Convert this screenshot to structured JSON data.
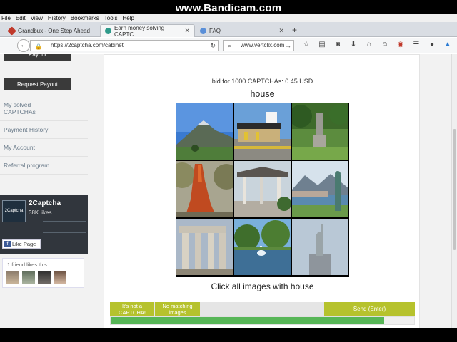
{
  "watermark": "www.Bandicam.com",
  "menu": [
    "File",
    "Edit",
    "View",
    "History",
    "Bookmarks",
    "Tools",
    "Help"
  ],
  "tabs": [
    {
      "label": "Grandbux - One Step Ahead",
      "icon": "grandbux-favicon",
      "color": "#c0392b"
    },
    {
      "label": "Earn money solving CAPTC...",
      "icon": "2captcha-favicon",
      "color": "#2e9a8a"
    },
    {
      "label": "FAQ",
      "icon": "globe-favicon",
      "color": "#5a8fd8"
    }
  ],
  "new_tab": "+",
  "url": "https://2captcha.com/cabinet",
  "search": "www.vertclix.com",
  "sidebar": {
    "button_top": "Payout",
    "request_payout": "Request Payout",
    "links": [
      "My solved CAPTCHAs",
      "Payment History",
      "My Account",
      "Referral program"
    ]
  },
  "facebook": {
    "logo": "2Captcha",
    "name": "2Captcha",
    "likes": "38K likes",
    "like_button": "Like Page",
    "friends": "1 friend likes this"
  },
  "captcha": {
    "bid": "bid for 1000 CAPTCHAs: 0.45 USD",
    "word": "house",
    "instruction": "Click all images with house",
    "not_captcha": "It's not a CAPTCHA!",
    "no_match": "No matching images",
    "send": "Send (Enter)",
    "progress": 0.9
  },
  "colors": {
    "accent": "#b6c22d",
    "progress": "#57b657",
    "sidebar_button": "#3a3a3a"
  }
}
